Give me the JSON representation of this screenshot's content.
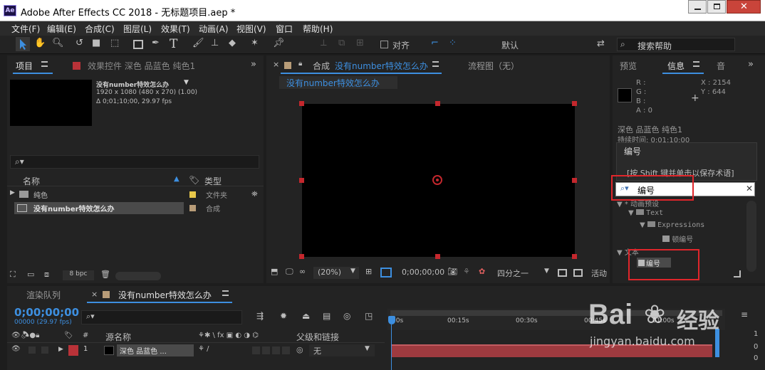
{
  "window": {
    "title": "Adobe After Effects CC 2018 - 无标题项目.aep *",
    "app_badge": "Ae"
  },
  "menu": [
    "文件(F)",
    "编辑(E)",
    "合成(C)",
    "图层(L)",
    "效果(T)",
    "动画(A)",
    "视图(V)",
    "窗口",
    "帮助(H)"
  ],
  "toolbar": {
    "align_label": "对齐",
    "workspace": "默认",
    "search_placeholder": "搜索帮助"
  },
  "project_panel": {
    "tab": "项目",
    "effects_tab": "效果控件 深色 品蓝色 纯色1",
    "comp_name": "没有number特效怎么办",
    "comp_size": "1920 x 1080  (480 x 270) (1.00)",
    "comp_duration": "Δ 0;01;10;00, 29.97 fps",
    "col_name": "名称",
    "col_type": "类型",
    "items": [
      {
        "name": "纯色",
        "type": "文件夹",
        "color": "#e8c84a"
      },
      {
        "name": "没有number特效怎么办",
        "type": "合成",
        "color": "#b89c78"
      }
    ],
    "bpc": "8 bpc"
  },
  "comp_panel": {
    "tab_label": "合成",
    "tab_name": "没有number特效怎么办",
    "flow_tab": "流程图（无）",
    "breadcrumb": "没有number特效怎么办",
    "zoom": "(20%)",
    "timecode": "0;00;00;00",
    "resolution": "四分之一",
    "active_label": "活动"
  },
  "info_panel": {
    "tabs": [
      "预览",
      "信息",
      "音"
    ],
    "rgba_labels": [
      "R :",
      "G :",
      "B :",
      "A : 0"
    ],
    "x": "X : 2154",
    "y": "Y : 644",
    "layer_name": "深色 品蓝色 纯色1",
    "duration": "持续时间: 0:01:10:00",
    "tooltip_title": "编号",
    "tooltip_hint": "[按 Shift 键并单击以保存术语]"
  },
  "effects_panel": {
    "search_value": "编号",
    "tree": [
      {
        "label": "▼ * 动画预设",
        "depth": 0
      },
      {
        "label": "Text",
        "depth": 1
      },
      {
        "label": "Expressions",
        "depth": 2
      },
      {
        "label": "顿编号",
        "depth": 3
      },
      {
        "label": "▼ 文本",
        "depth": 0
      },
      {
        "label": "编号",
        "depth": 1
      }
    ]
  },
  "timeline": {
    "render_tab": "渲染队列",
    "comp_tab": "没有number特效怎么办",
    "timecode": "0;00;00;00",
    "frame_info": "00000 (29.97 fps)",
    "col_layer_name": "源名称",
    "col_parent": "父级和链接",
    "ruler": [
      "00s",
      "00:15s",
      "00:30s",
      "00:45s",
      "01:00s"
    ],
    "layer_index": "1",
    "layer_name": "深色 品蓝色 ...",
    "parent_value": "无",
    "right_values": [
      "1",
      "0",
      "0"
    ]
  },
  "watermark": {
    "brand": "Bai",
    "brand2": "经验",
    "url": "jingyan.baidu.com"
  },
  "colors": {
    "accent": "#3d8fe0",
    "highlight_box": "#e0262b",
    "layer_bar": "#9e3a3f"
  }
}
